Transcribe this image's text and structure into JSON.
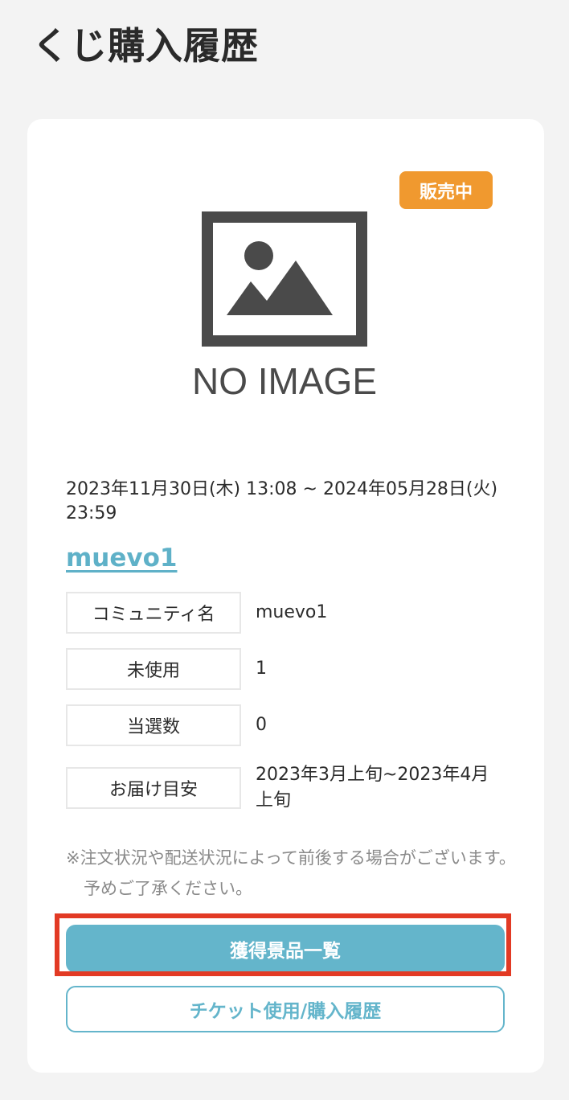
{
  "header": {
    "title": "くじ購入履歴"
  },
  "card": {
    "status_badge": "販売中",
    "image": {
      "icon": "no-image-icon",
      "text": "NO IMAGE"
    },
    "period": "2023年11月30日(木) 13:08 ~ 2024年05月28日(火) 23:59",
    "community_link": "muevo1",
    "info_rows": [
      {
        "label": "コミュニティ名",
        "value": "muevo1"
      },
      {
        "label": "未使用",
        "value": "1"
      },
      {
        "label": "当選数",
        "value": "0"
      },
      {
        "label": "お届け目安",
        "value": "2023年3月上旬~2023年4月上旬"
      }
    ],
    "note": "※注文状況や配送状況によって前後する場合がございます。予めご了承ください。",
    "buttons": {
      "prizes": "獲得景品一覧",
      "ticket_history": "チケット使用/購入履歴"
    }
  },
  "colors": {
    "badge": "#f0992f",
    "accent": "#64b5cb",
    "highlight": "#e23a24",
    "link": "#5fb1c8"
  }
}
